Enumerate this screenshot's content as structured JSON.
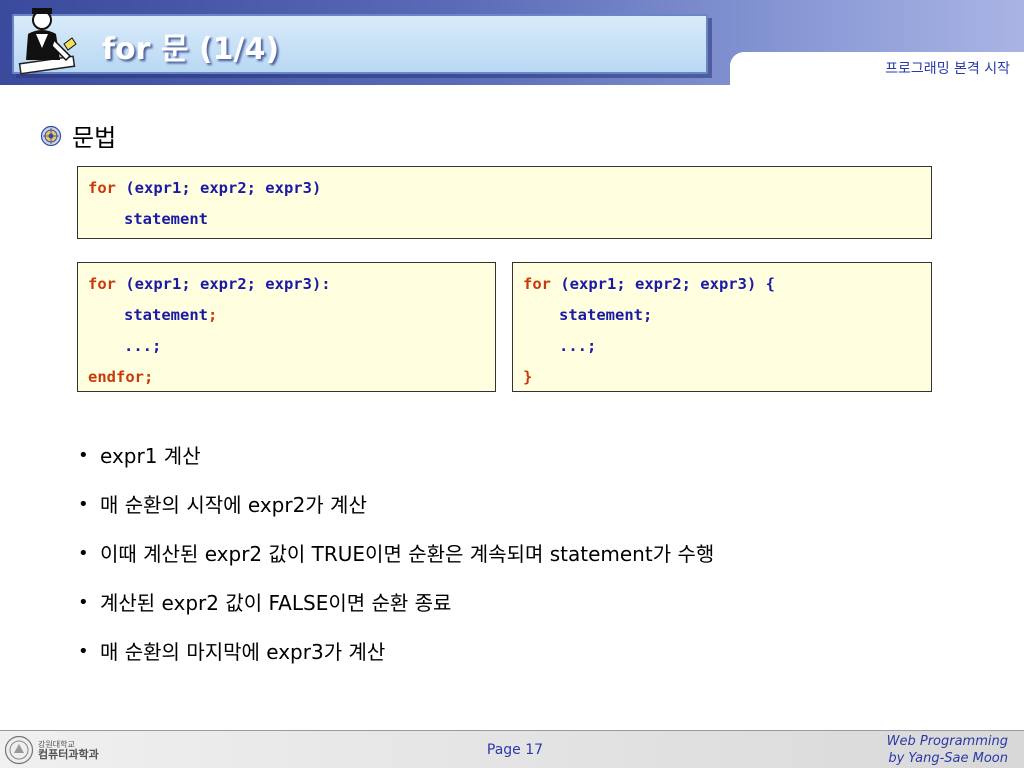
{
  "header": {
    "title": "for 문 (1/4)",
    "subtitle": "프로그래밍 본격 시작"
  },
  "section": {
    "title": "문법",
    "icon": "bullet-globe-icon"
  },
  "code_blocks": {
    "box1": {
      "l1_kw": "for",
      "l1_rest": " (expr1; expr2; expr3)",
      "l2": "statement"
    },
    "box2": {
      "l1_kw": "for",
      "l1_rest": " (expr1; expr2; expr3):",
      "l2": "statement",
      "l2_tail": ";",
      "l3": "...;",
      "l4": "endfor;"
    },
    "box3": {
      "l1_kw": "for",
      "l1_rest": " (expr1; expr2; expr3) {",
      "l2": "statement",
      "l2_tail": ";",
      "l3": "...;",
      "l4": "}"
    }
  },
  "bullets": [
    "expr1 계산",
    "매 순환의 시작에 expr2가 계산",
    "이때 계산된 expr2 값이 TRUE이면 순환은 계속되며 statement가 수행",
    "계산된 expr2 값이 FALSE이면 순환 종료",
    "매 순환의 마지막에 expr3가 계산"
  ],
  "bullet_symbol": "•",
  "footer": {
    "page": "Page 17",
    "credit_line1": "Web Programming",
    "credit_line2": "by Yang-Sae Moon",
    "dept_line1": "강원대학교",
    "dept_line2": "컴퓨터과학과"
  },
  "colors": {
    "keyword": "#c83a0a",
    "code_text": "#1a1aa6",
    "code_bg": "#ffffe0",
    "accent_blue": "#2a3aa8"
  }
}
